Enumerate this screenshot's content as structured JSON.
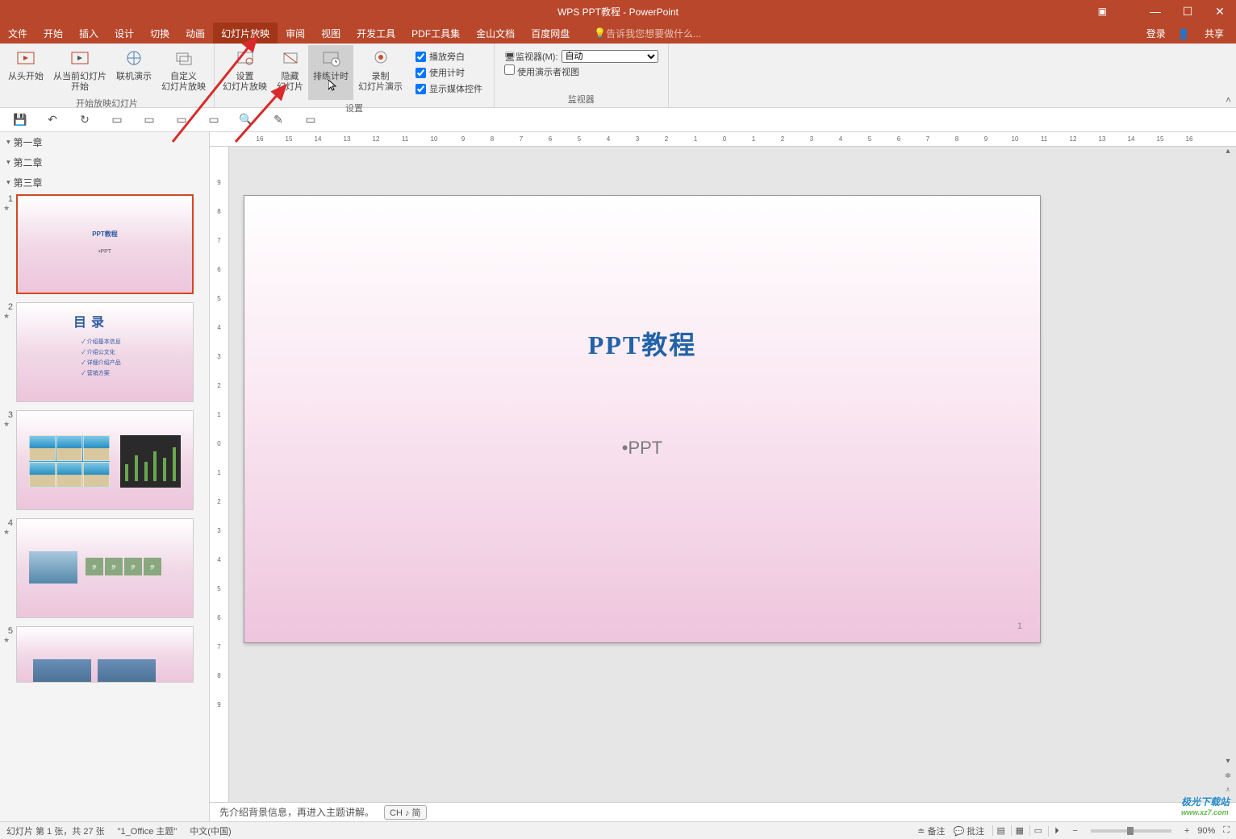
{
  "window": {
    "title": "WPS PPT教程 - PowerPoint"
  },
  "menubar": {
    "tabs": [
      "文件",
      "开始",
      "插入",
      "设计",
      "切换",
      "动画",
      "幻灯片放映",
      "审阅",
      "视图",
      "开发工具",
      "PDF工具集",
      "金山文档",
      "百度网盘"
    ],
    "active_index": 6,
    "tellme": "告诉我您想要做什么...",
    "login": "登录",
    "share": "共享"
  },
  "ribbon": {
    "group1": {
      "label": "开始放映幻灯片",
      "buttons": [
        {
          "label": "从头开始"
        },
        {
          "label": "从当前幻灯片\n开始"
        },
        {
          "label": "联机演示"
        },
        {
          "label": "自定义\n幻灯片放映"
        }
      ]
    },
    "group2": {
      "label": "设置",
      "buttons": [
        {
          "label": "设置\n幻灯片放映"
        },
        {
          "label": "隐藏\n幻灯片"
        },
        {
          "label": "排练计时"
        },
        {
          "label": "录制\n幻灯片演示"
        }
      ],
      "checks": [
        {
          "label": "播放旁白",
          "checked": true
        },
        {
          "label": "使用计时",
          "checked": true
        },
        {
          "label": "显示媒体控件",
          "checked": true
        }
      ]
    },
    "group3": {
      "label": "监视器",
      "monitor_label": "监视器(M):",
      "monitor_value": "自动",
      "presenter_view": "使用演示者视图"
    }
  },
  "outline": {
    "sections": [
      "第一章",
      "第二章",
      "第三章"
    ],
    "slides": [
      {
        "num": "1",
        "title": "PPT教程",
        "sub": "•PPT"
      },
      {
        "num": "2",
        "toc_title": "目录",
        "toc_items": [
          "✓ 介绍基本信息",
          "✓ 介绍公文化",
          "✓ 详细介绍产品",
          "✓ 营销方案"
        ]
      },
      {
        "num": "3"
      },
      {
        "num": "4",
        "steps": [
          "步",
          "步",
          "步",
          "步"
        ]
      },
      {
        "num": "5"
      }
    ]
  },
  "ruler_h": [
    "16",
    "15",
    "14",
    "13",
    "12",
    "11",
    "10",
    "9",
    "8",
    "7",
    "6",
    "5",
    "4",
    "3",
    "2",
    "1",
    "0",
    "1",
    "2",
    "3",
    "4",
    "5",
    "6",
    "7",
    "8",
    "9",
    "10",
    "11",
    "12",
    "13",
    "14",
    "15",
    "16"
  ],
  "ruler_v": [
    "9",
    "8",
    "7",
    "6",
    "5",
    "4",
    "3",
    "2",
    "1",
    "0",
    "1",
    "2",
    "3",
    "4",
    "5",
    "6",
    "7",
    "8",
    "9"
  ],
  "slide": {
    "title": "PPT教程",
    "body": "•PPT",
    "pagenum": "1"
  },
  "notes": {
    "text": "先介绍背景信息，再进入主题讲解。",
    "ime": "CH ♪ 简"
  },
  "statusbar": {
    "slide_info": "幻灯片 第 1 张，共 27 张",
    "theme": "\"1_Office 主题\"",
    "lang": "中文(中国)",
    "notes_btn": "备注",
    "comments_btn": "批注",
    "zoom": "90%"
  },
  "watermark": {
    "line1": "极光下载站",
    "line2": "www.xz7.com"
  }
}
